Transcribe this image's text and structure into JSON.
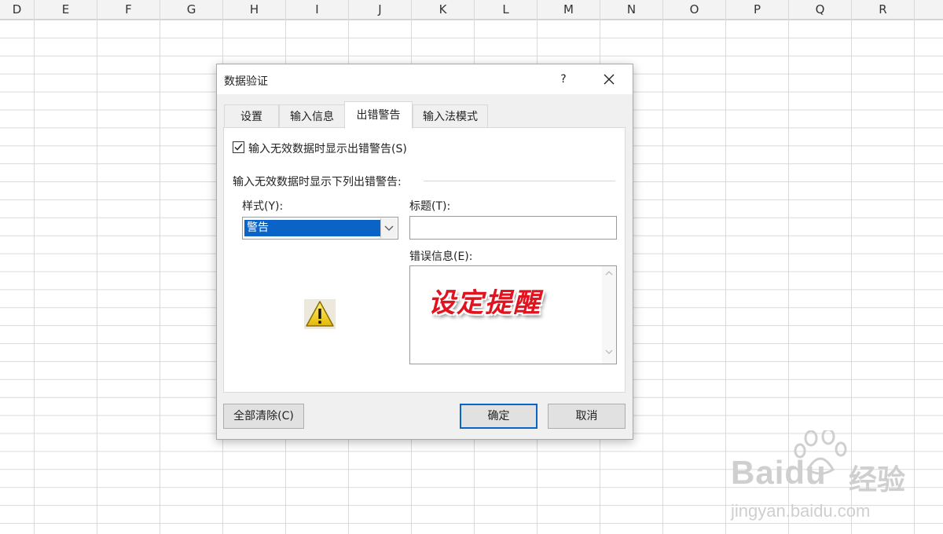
{
  "spreadsheet": {
    "columns": [
      "D",
      "E",
      "F",
      "G",
      "H",
      "I",
      "J",
      "K",
      "L",
      "M",
      "N",
      "O",
      "P",
      "Q",
      "R"
    ]
  },
  "dialog": {
    "title": "数据验证",
    "help": "?",
    "tabs": [
      {
        "label": "设置"
      },
      {
        "label": "输入信息"
      },
      {
        "label": "出错警告",
        "active": true
      },
      {
        "label": "输入法模式"
      }
    ],
    "show_error_checkbox": {
      "label": "输入无效数据时显示出错警告(S)",
      "checked": true
    },
    "section_label": "输入无效数据时显示下列出错警告:",
    "style": {
      "label": "样式(Y):",
      "value": "警告",
      "icon": "warning-triangle-icon"
    },
    "title_field": {
      "label": "标题(T):",
      "value": ""
    },
    "error_message": {
      "label": "错误信息(E):",
      "value": ""
    },
    "overlay_annotation": "设定提醒",
    "buttons": {
      "clear_all": "全部清除(C)",
      "ok": "确定",
      "cancel": "取消"
    }
  },
  "watermark": {
    "brand": "Baidu",
    "suffix": "经验",
    "url": "jingyan.baidu.com"
  }
}
